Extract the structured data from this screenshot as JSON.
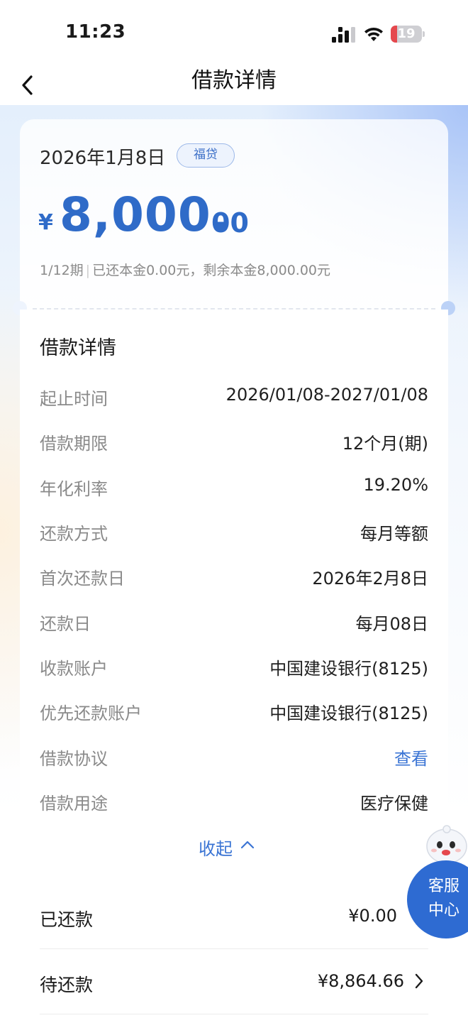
{
  "status_bar": {
    "time": "11:23",
    "battery": "19",
    "battery_color": "#e5484d"
  },
  "nav": {
    "title": "借款详情",
    "back_icon": "chevron-left-icon"
  },
  "loan": {
    "date": "2026年1月8日",
    "badge": "福贷",
    "currency": "¥",
    "amount_int": "8,000.",
    "amount_dec": "00",
    "summary_period": "1/12期",
    "summary_separator": "|",
    "summary_text": "已还本金0.00元，剩余本金8,000.00元",
    "accent_color": "#2f6bc8"
  },
  "details": {
    "title": "借款详情",
    "rows": [
      {
        "label": "起止时间",
        "value": "2026/01/08-2027/01/08"
      },
      {
        "label": "借款期限",
        "value": "12个月(期)"
      },
      {
        "label": "年化利率",
        "value": "19.20%"
      },
      {
        "label": "还款方式",
        "value": "每月等额"
      },
      {
        "label": "首次还款日",
        "value": "2026年2月8日"
      },
      {
        "label": "还款日",
        "value": "每月08日"
      },
      {
        "label": "收款账户",
        "value": "中国建设银行(8125)"
      },
      {
        "label": "优先还款账户",
        "value": "中国建设银行(8125)"
      },
      {
        "label": "借款协议",
        "value": "查看"
      },
      {
        "label": "借款用途",
        "value": "医疗保健"
      }
    ],
    "collapse_label": "收起",
    "link_color": "#3a74d4"
  },
  "summary": {
    "repaid_label": "已还款",
    "repaid_value": "¥0.00",
    "pending_label": "待还款",
    "pending_value": "¥8,864.66"
  },
  "customer_service": {
    "line1": "客服",
    "line2": "中心",
    "color": "#2e6bd2",
    "mascot_icon": "mascot-icon"
  }
}
